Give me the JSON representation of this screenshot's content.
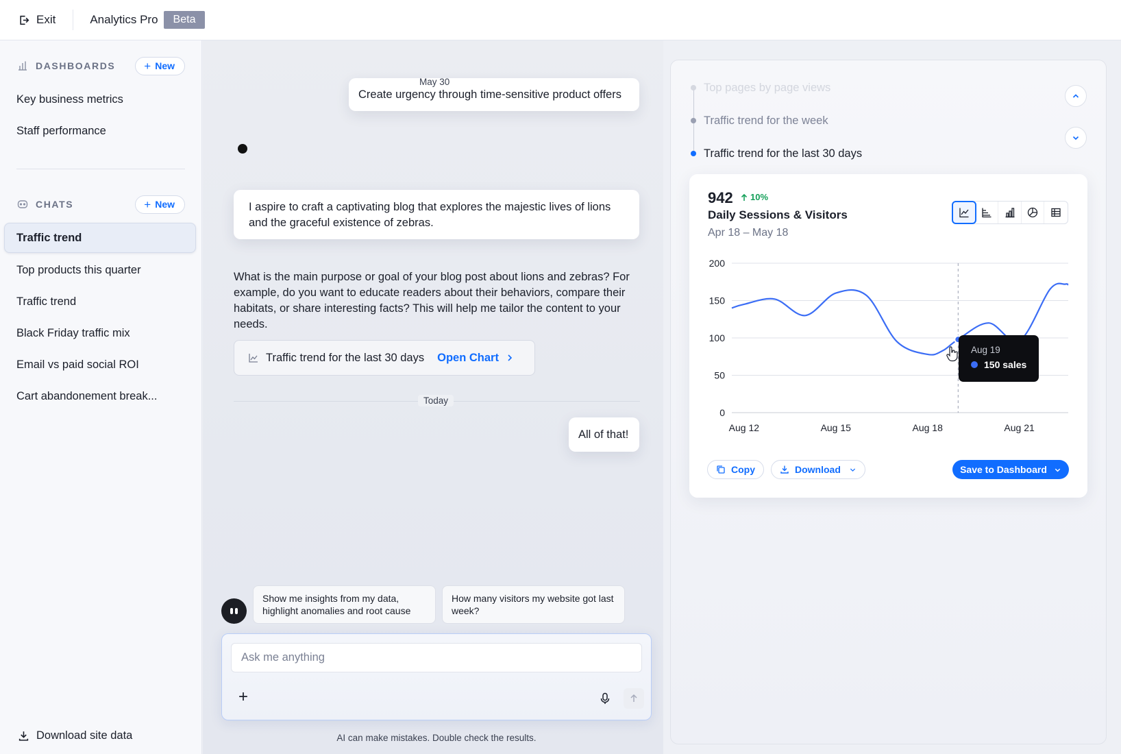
{
  "topbar": {
    "exit_label": "Exit",
    "app_title": "Analytics Pro",
    "beta_label": "Beta"
  },
  "sidebar": {
    "dashboards": {
      "title": "DASHBOARDS",
      "new_label": "New",
      "items": [
        "Key business metrics",
        "Staff performance"
      ]
    },
    "chats": {
      "title": "CHATS",
      "new_label": "New",
      "active_item": "Traffic trend",
      "items": [
        "Top products this quarter",
        "Traffic trend",
        "Black Friday traffic mix",
        "Email vs paid social ROI",
        "Cart abandonement break..."
      ]
    },
    "download_label": "Download site data"
  },
  "chat": {
    "date_1": "May 30",
    "msg_1": "Create urgency through time-sensitive product offers",
    "msg_2": "I aspire to craft a captivating blog that explores the majestic lives of lions and the graceful existence of zebras.",
    "ai_reply": "What is the main purpose or goal of your blog post about lions and zebras? For example, do you want to educate readers about their behaviors, compare their habitats, or share interesting facts? This will help me tailor the content to your needs.",
    "chart_card_label": "Traffic trend for the last 30 days",
    "open_chart_label": "Open Chart",
    "date_2": "Today",
    "msg_3": "All of that!",
    "suggestions": [
      "Show me insights from my data, highlight anomalies and root cause",
      "How many visitors my website got last week?"
    ],
    "input_placeholder": "Ask me anything",
    "disclaimer": "AI can make mistakes. Double check the results."
  },
  "panel": {
    "history": [
      "Top pages by page views",
      "Traffic trend for the week",
      "Traffic trend for the last 30 days"
    ],
    "active_history_index": 2,
    "card": {
      "kpi_value": "942",
      "kpi_delta": "10%",
      "title": "Daily Sessions & Visitors",
      "range": "Apr 18 – May 18",
      "chart_types": [
        "line-chart-icon",
        "horizontal-bar-icon",
        "bar-chart-icon",
        "pie-chart-icon",
        "table-icon"
      ],
      "tooltip": {
        "date": "Aug 19",
        "value": "150 sales"
      },
      "copy_label": "Copy",
      "download_label": "Download",
      "save_label": "Save to Dashboard"
    }
  },
  "colors": {
    "accent": "#116dff",
    "line": "#3b6df5",
    "positive": "#15a05a"
  },
  "chart_data": {
    "type": "line",
    "x_tick_labels": [
      "Aug 12",
      "Aug 15",
      "Aug 18",
      "Aug 21"
    ],
    "y_ticks": [
      0,
      50,
      100,
      150,
      200
    ],
    "ylim": [
      0,
      200
    ],
    "grid": true,
    "series": [
      {
        "x": [
          11.6,
          12,
          13,
          14,
          15,
          16,
          17,
          18,
          18.5,
          19,
          20,
          21,
          22,
          22.5,
          22.6
        ],
        "values": [
          140,
          145,
          152,
          130,
          160,
          157,
          95,
          78,
          83,
          98,
          120,
          96,
          165,
          172,
          171
        ]
      }
    ],
    "highlight": {
      "x": 19,
      "y": 98,
      "label": "Aug 19"
    }
  }
}
